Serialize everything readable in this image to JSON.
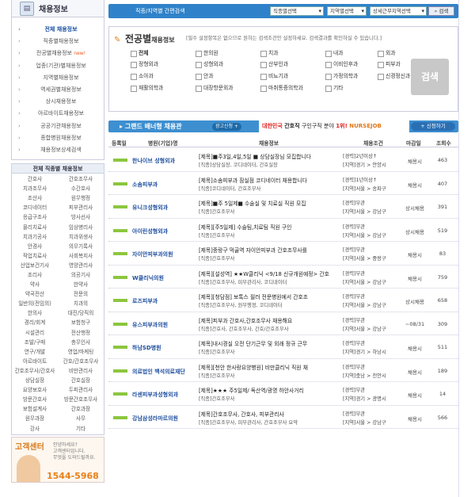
{
  "sidebar": {
    "title": "채용정보",
    "menu": [
      {
        "label": "전체 채용정보",
        "on": true
      },
      {
        "label": "직종별채용정보"
      },
      {
        "label": "전공별채용정보",
        "new": "new!"
      },
      {
        "label": "업종(기관)별채용정보"
      },
      {
        "label": "지역별채용정보"
      },
      {
        "label": "역세권별채용정보"
      },
      {
        "label": "상시채용정보"
      },
      {
        "label": "아르바이트채용정보"
      },
      {
        "label": "공공기관채용정보"
      },
      {
        "label": "종합병원채용정보"
      },
      {
        "label": "채용정보상세검색"
      }
    ],
    "sub_title": "전체 직종별 채용정보",
    "jobs": [
      "간호사",
      "간호조무사",
      "치과조무사",
      "수간호사",
      "조산사",
      "원무행정",
      "코디네이터",
      "피부관리사",
      "응급구조사",
      "방사선사",
      "물리치료사",
      "임상병리사",
      "치과기공사",
      "치과위생사",
      "안경사",
      "의무기록사",
      "작업치료사",
      "사회복지사",
      "산업보건기사",
      "영양관리사",
      "조리사",
      "의공기사",
      "약사",
      "한약사",
      "약국전산",
      "전문의",
      "일반의(전임의)",
      "치과의",
      "한의사",
      "대진/당직의",
      "경리/회계",
      "보험청구",
      "시설관리",
      "전산행정",
      "조발/구매",
      "총무인사",
      "연구/개발",
      "영업/마케팅",
      "아르바이트",
      "간호/간호조무사",
      "간호조무사/간호사",
      "비만관리사",
      "상담실장",
      "간호실장",
      "요양보호사",
      "두피관리사",
      "방문간호사",
      "방문간호조무사",
      "보험설계사",
      "간호과장",
      "원무과장",
      "사무",
      "강사",
      "기타"
    ],
    "cs": {
      "title": "고객센터",
      "line1": "안녕하세요?",
      "line2": "고객센터입니다.",
      "line3": "무엇을 도와드릴까요.",
      "phone": "1544-5968"
    }
  },
  "search": {
    "label": "직종/지역별 간편검색",
    "sel1": "직종별선택",
    "sel2": "지역별선택",
    "sel3": "상세근무지역선택",
    "btn": "검색"
  },
  "spec": {
    "title": "전공별",
    "title_sm": "채용정보",
    "note": "[필수 설정항목은 없으므로 원하는 검색조건만 설정하세요. 검색결과를 확인하실 수 있습니다.]",
    "options": [
      "전체",
      "한의원",
      "치과",
      "내과",
      "외과",
      "정형외과",
      "성형외과",
      "산부인과",
      "이비인후과",
      "피부과",
      "소아과",
      "안과",
      "비뇨기과",
      "가정의학과",
      "신경정신과",
      "재활의학과",
      "대장항문외과",
      "마취통증의학과",
      "기타"
    ],
    "go": "검색"
  },
  "grand": {
    "title": "그랜드 배너형 채용관",
    "more": "광고신청 +",
    "ad_a": "대한민국",
    "ad_b": "간호직",
    "ad_c": "구인구직 분야",
    "ad_d": "1위!",
    "ad_e": "NURSEJOB",
    "apply": "+ 신청하기"
  },
  "table": {
    "headers": [
      "등록일",
      "병원(기업)명",
      "채용정보",
      "채용조건",
      "마감일",
      "조회수"
    ],
    "rows": [
      {
        "co": "한나이브 성형외과",
        "title": "[제목]■주3일,4일,5일 ■ 상담실장님 모집합니다",
        "sub": "[직종]상담실장, 코디네이터, 간호실장",
        "c1": "[경력]2년이상↑",
        "c2": "[지역]경기 > 안양시",
        "dl": "채용시",
        "vw": "463"
      },
      {
        "co": "소솜피부과",
        "title": "[제목]소솜피부과 잠실점 코디네이터 채용합니다",
        "sub": "[직종]코디네이터, 간호조무사",
        "c1": "[경력]1년이상↑",
        "c2": "[지역]서울 > 송파구",
        "dl": "채용시",
        "vw": "407"
      },
      {
        "co": "유니크성형외과",
        "title": "[제목]■주 5일제■ 수술실 및 치료실 직원 모집",
        "sub": "[직종]간호조무사",
        "c1": "[경력]무관",
        "c2": "[지역]서울 > 강남구",
        "dl": "상시채용",
        "vw": "391"
      },
      {
        "co": "아이린성형외과",
        "title": "[제목][주5일제] 수술팀,치료팀 직원 구인",
        "sub": "[직종]간호조무사",
        "c1": "[경력]무관",
        "c2": "[지역]서울 > 강남구",
        "dl": "상시채용",
        "vw": "519"
      },
      {
        "co": "자이안피부과의원",
        "title": "[제목]중랑구 먹골역 자이안피부과 간호조무사를",
        "sub": "[직종]간호조무사",
        "c1": "[경력]무관",
        "c2": "[지역]서울 > 중랑구",
        "dl": "채용시",
        "vw": "83"
      },
      {
        "co": "W클리닉의원",
        "title": "[제목][설성역] ★★W클리닉 <9/18 신규개원예정> 간호",
        "sub": "[직종]간호조무사, 피부관리사, 코디네이터",
        "c1": "[경력]무관",
        "c2": "[지역]서울 > 강남구",
        "dl": "채용시",
        "vw": "759"
      },
      {
        "co": "로즈피부과",
        "title": "[제목][청담점] 보톡스 필러 전문병원에서 간호조",
        "sub": "[직종]간호조무사, 원무행정, 코디네이터",
        "c1": "[경력]무관",
        "c2": "[지역]서울 > 강남구",
        "dl": "상시채용",
        "vw": "658"
      },
      {
        "co": "유스피부과의원",
        "title": "[제목]피부과 간호사,간호조무사 채용해요",
        "sub": "[직종]간호사, 간호조무사, 간호/간호조무사",
        "c1": "[경력]무관",
        "c2": "[지역]서울 > 강남구",
        "dl": "~08/31",
        "vw": "309"
      },
      {
        "co": "하남SD병원",
        "title": "[제목]내시경실 오전 단기근무 및 외래 정규 근무",
        "sub": "[직종]간호조무사",
        "c1": "[경력]무관",
        "c2": "[지역]경기 > 하남시",
        "dl": "채용시",
        "vw": "511"
      },
      {
        "co": "의료법인 백석의료재단",
        "title": "[제목][천안 한사랑요양병원] 비만클리닉 직원 채",
        "sub": "[직종]간호조무사",
        "c1": "[경력]무관",
        "c2": "[지역]충남 > 천안시",
        "dl": "채용시",
        "vw": "189"
      },
      {
        "co": "라센피부과성형외과",
        "title": "[제목]★★★ 주5일제/ 독산역/광명 하안사거리",
        "sub": "[직종]간호조무사",
        "c1": "[경력]무관",
        "c2": "[지역]경기 > 광명시",
        "dl": "채용시",
        "vw": "14"
      },
      {
        "co": "강남삼성라마르의원",
        "title": "[제목]간호조무사, 간호사, 피부관리사",
        "sub": "[직종]간호조무사, 피부관리사, 간호조무사 요약",
        "c1": "[경력]무관",
        "c2": "[지역]서울 > 강남구",
        "dl": "채용시",
        "vw": "566"
      }
    ]
  }
}
